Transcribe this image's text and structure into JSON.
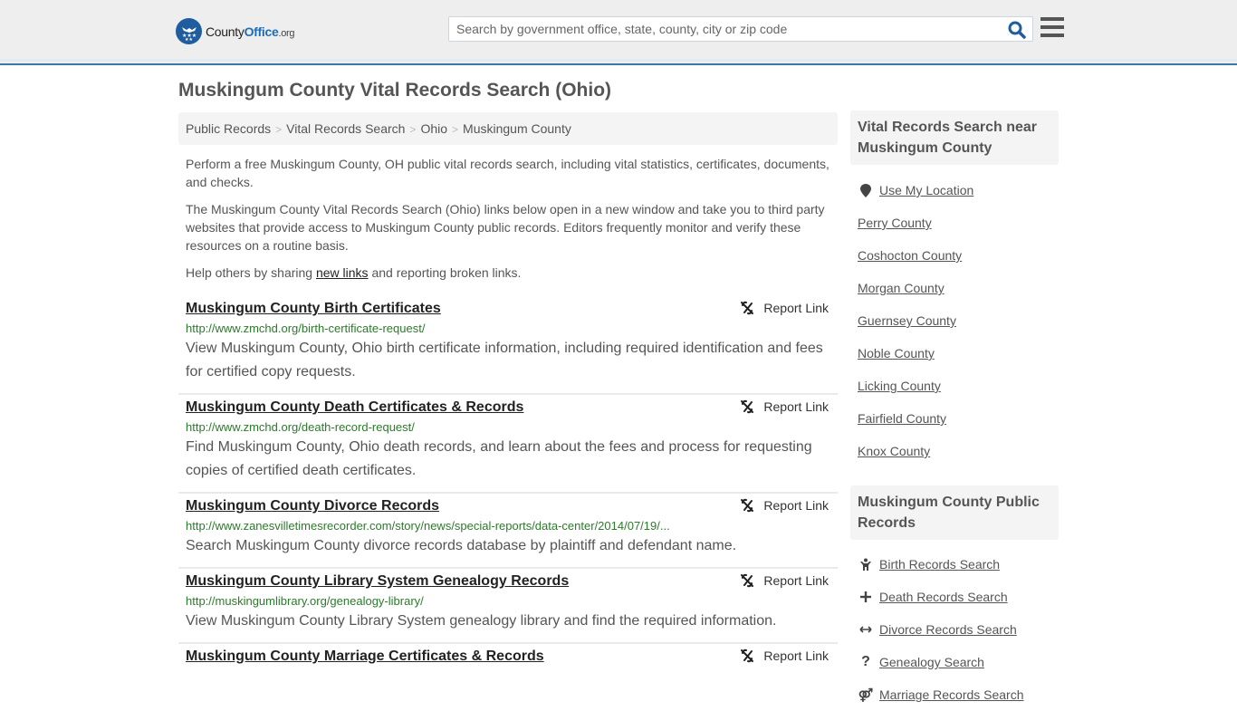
{
  "header": {
    "logo": {
      "name": "County",
      "name_bold": "Office",
      "tld": ".org"
    },
    "search": {
      "placeholder": "Search by government office, state, county, city or zip code",
      "value": ""
    },
    "icons": {
      "search": "search-icon",
      "menu": "hamburger-menu-icon"
    }
  },
  "page": {
    "title": "Muskingum County Vital Records Search (Ohio)",
    "breadcrumb": [
      "Public Records",
      "Vital Records Search",
      "Ohio",
      "Muskingum County"
    ],
    "breadcrumb_separator": ">",
    "intro": {
      "p1": "Perform a free Muskingum County, OH public vital records search, including vital statistics, certificates, documents, and checks.",
      "p2": "The Muskingum County Vital Records Search (Ohio) links below open in a new window and take you to third party websites that provide access to Muskingum County public records. Editors frequently monitor and verify these resources on a routine basis.",
      "p3_before": "Help others by sharing ",
      "p3_link": "new links",
      "p3_after": " and reporting broken links."
    },
    "report_link_label": "Report Link",
    "results": [
      {
        "title": "Muskingum County Birth Certificates",
        "url": "http://www.zmchd.org/birth-certificate-request/",
        "description": "View Muskingum County, Ohio birth certificate information, including required identification and fees for certified copy requests."
      },
      {
        "title": "Muskingum County Death Certificates & Records",
        "url": "http://www.zmchd.org/death-record-request/",
        "description": "Find Muskingum County, Ohio death records, and learn about the fees and process for requesting copies of certified death certificates."
      },
      {
        "title": "Muskingum County Divorce Records",
        "url": "http://www.zanesvilletimesrecorder.com/story/news/special-reports/data-center/2014/07/19/...",
        "description": "Search Muskingum County divorce records database by plaintiff and defendant name."
      },
      {
        "title": "Muskingum County Library System Genealogy Records",
        "url": "http://muskingumlibrary.org/genealogy-library/",
        "description": "View Muskingum County Library System genealogy library and find the required information."
      },
      {
        "title": "Muskingum County Marriage Certificates & Records",
        "url": "",
        "description": ""
      }
    ]
  },
  "sidebar": {
    "nearby": {
      "heading": "Vital Records Search near Muskingum County",
      "use_location": "Use My Location",
      "items": [
        "Perry County",
        "Coshocton County",
        "Morgan County",
        "Guernsey County",
        "Noble County",
        "Licking County",
        "Fairfield County",
        "Knox County"
      ]
    },
    "public_records": {
      "heading": "Muskingum County Public Records",
      "items": [
        {
          "label": "Birth Records Search",
          "icon": "child-icon"
        },
        {
          "label": "Death Records Search",
          "icon": "plus-icon"
        },
        {
          "label": "Divorce Records Search",
          "icon": "arrows-horizontal-icon"
        },
        {
          "label": "Genealogy Search",
          "icon": "question-icon"
        },
        {
          "label": "Marriage Records Search",
          "icon": "venus-mars-icon"
        }
      ]
    }
  },
  "colors": {
    "header_bg": "#eeeeee",
    "header_border": "#3a78a8",
    "brand_blue": "#1f5d9e",
    "url_green": "#2c7a2c",
    "text": "#555555"
  }
}
